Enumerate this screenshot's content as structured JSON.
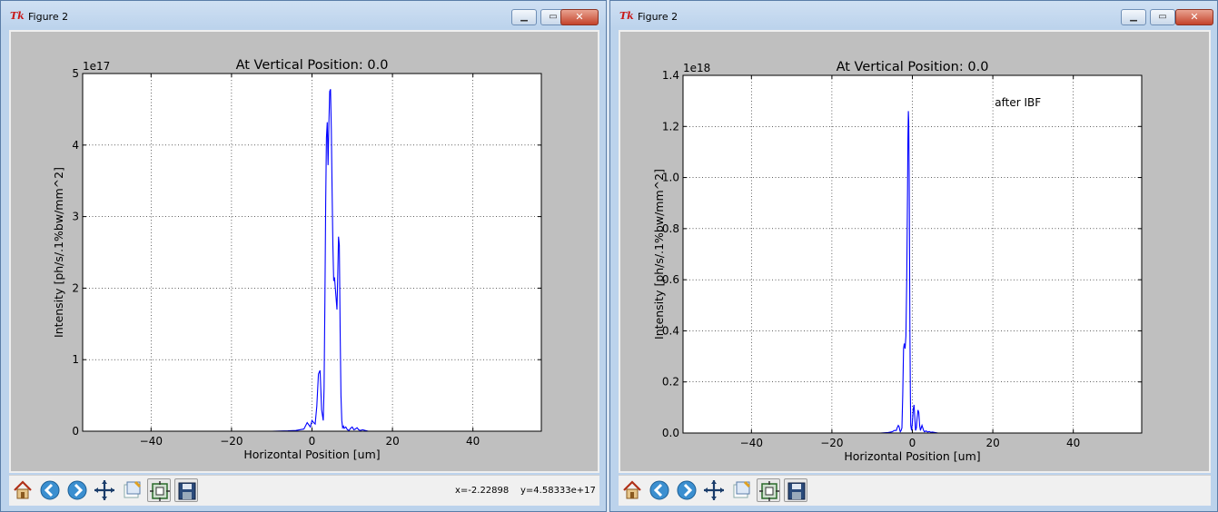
{
  "windows": [
    {
      "title": "Figure 2",
      "coords": {
        "x_text": "x=-2.22898",
        "y_text": "y=4.58333e+17"
      }
    },
    {
      "title": "Figure 2",
      "coords": {
        "x_text": "",
        "y_text": ""
      }
    }
  ],
  "toolbar_icons": [
    "home-icon",
    "back-icon",
    "forward-icon",
    "pan-icon",
    "zoom-icon",
    "subplots-icon",
    "save-icon"
  ],
  "chart_data": [
    {
      "type": "line",
      "title": "At Vertical Position: 0.0",
      "xlabel": "Horizontal Position [um]",
      "ylabel": "Intensity [ph/s/.1%bw/mm^2]",
      "offset_text": "1e17",
      "xlim": [
        -57,
        57
      ],
      "ylim": [
        0,
        5
      ],
      "xticks": [
        -40,
        -20,
        0,
        20,
        40
      ],
      "xtick_labels": [
        "−40",
        "−20",
        "0",
        "20",
        "40"
      ],
      "yticks": [
        0,
        1,
        2,
        3,
        4,
        5
      ],
      "ytick_labels": [
        "0",
        "1",
        "2",
        "3",
        "4",
        "5"
      ],
      "grid": true,
      "line_color": "#0000ff",
      "annotation": "",
      "series": [
        {
          "x": [
            -10,
            -6,
            -4,
            -2,
            -1.2,
            -0.4,
            0,
            0.4,
            0.8,
            1.2,
            1.6,
            2.0,
            2.4,
            2.8,
            3.0,
            3.2,
            3.4,
            3.6,
            3.8,
            4.0,
            4.2,
            4.4,
            4.6,
            4.8,
            5.0,
            5.2,
            5.4,
            5.6,
            5.8,
            6.0,
            6.2,
            6.4,
            6.6,
            6.8,
            7.0,
            7.2,
            7.4,
            7.6,
            7.8,
            8.0,
            8.4,
            8.8,
            9.2,
            9.6,
            10.0,
            10.4,
            10.8,
            11.2,
            11.6,
            12.0,
            12.6,
            13.2,
            14.0
          ],
          "y": [
            0,
            0.005,
            0.01,
            0.03,
            0.12,
            0.06,
            0.15,
            0.12,
            0.1,
            0.35,
            0.8,
            0.85,
            0.3,
            0.15,
            0.6,
            1.8,
            3.2,
            4.1,
            4.32,
            3.72,
            4.3,
            4.75,
            4.78,
            4.2,
            3.4,
            2.6,
            2.1,
            2.15,
            2.0,
            1.85,
            1.7,
            2.2,
            2.72,
            2.6,
            1.4,
            0.5,
            0.15,
            0.05,
            0.07,
            0.04,
            0.06,
            0.02,
            0.01,
            0.04,
            0.06,
            0.02,
            0.03,
            0.05,
            0.02,
            0.01,
            0.02,
            0.01,
            0
          ]
        }
      ]
    },
    {
      "type": "line",
      "title": "At Vertical Position: 0.0",
      "xlabel": "Horizontal Position [um]",
      "ylabel": "Intensity [ph/s/.1%bw/mm^2]",
      "offset_text": "1e18",
      "xlim": [
        -57,
        57
      ],
      "ylim": [
        0,
        1.4
      ],
      "xticks": [
        -40,
        -20,
        0,
        20,
        40
      ],
      "xtick_labels": [
        "−40",
        "−20",
        "0",
        "20",
        "40"
      ],
      "yticks": [
        0,
        0.2,
        0.4,
        0.6,
        0.8,
        1.0,
        1.2,
        1.4
      ],
      "ytick_labels": [
        "0.0",
        "0.2",
        "0.4",
        "0.6",
        "0.8",
        "1.0",
        "1.2",
        "1.4"
      ],
      "grid": true,
      "line_color": "#0000ff",
      "annotation": "after IBF",
      "series": [
        {
          "x": [
            -8,
            -6,
            -5,
            -4.5,
            -4,
            -3.8,
            -3.5,
            -3.3,
            -3.1,
            -3.0,
            -2.8,
            -2.6,
            -2.4,
            -2.2,
            -2.0,
            -1.8,
            -1.6,
            -1.4,
            -1.2,
            -1.1,
            -1.0,
            -0.9,
            -0.8,
            -0.7,
            -0.6,
            -0.5,
            -0.4,
            -0.2,
            0,
            0.2,
            0.4,
            0.6,
            0.8,
            1.0,
            1.2,
            1.4,
            1.6,
            1.8,
            2.0,
            2.2,
            2.4,
            2.6,
            2.8,
            3.0,
            3.4,
            3.8,
            4.2,
            4.6,
            5.0,
            5.6,
            6.4
          ],
          "y": [
            0,
            0.002,
            0.005,
            0.01,
            0.01,
            0.02,
            0.03,
            0.025,
            0.01,
            0.005,
            0.01,
            0.02,
            0.15,
            0.33,
            0.35,
            0.33,
            0.38,
            0.6,
            0.95,
            1.15,
            1.26,
            1.22,
            1.0,
            0.7,
            0.4,
            0.15,
            0.03,
            0.01,
            0.04,
            0.09,
            0.11,
            0.06,
            0.01,
            0.02,
            0.06,
            0.09,
            0.08,
            0.03,
            0.01,
            0.02,
            0.03,
            0.02,
            0.01,
            0.005,
            0.008,
            0.004,
            0.006,
            0.003,
            0.004,
            0.002,
            0
          ]
        }
      ]
    }
  ]
}
